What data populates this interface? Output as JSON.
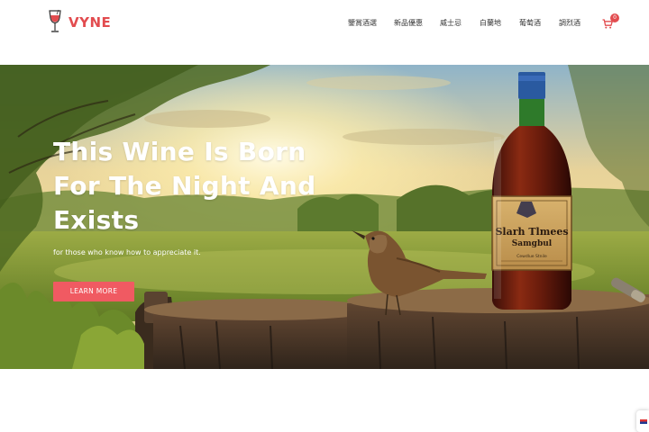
{
  "brand": {
    "name": "VYNE",
    "logo_icon": "wine-glass-icon"
  },
  "nav": {
    "items": [
      {
        "label": "鑒賞酒選"
      },
      {
        "label": "新品優惠"
      },
      {
        "label": "威士忌"
      },
      {
        "label": "白蘭地"
      },
      {
        "label": "葡萄酒"
      },
      {
        "label": "調烈酒"
      }
    ]
  },
  "cart": {
    "icon": "cart-icon",
    "count": "0"
  },
  "hero": {
    "title": "This Wine Is Born For The Night And Exists",
    "subtitle": "for those who know how to appreciate it.",
    "button_label": "LEARN MORE"
  },
  "bottle_label": {
    "line1": "Slarh Tlmees",
    "line2": "Samgbul",
    "line3": "Cewdlue Stnile"
  },
  "language_widget": {
    "icon": "flag-icon"
  },
  "colors": {
    "accent": "#e24c4f",
    "button": "#f05a62"
  }
}
